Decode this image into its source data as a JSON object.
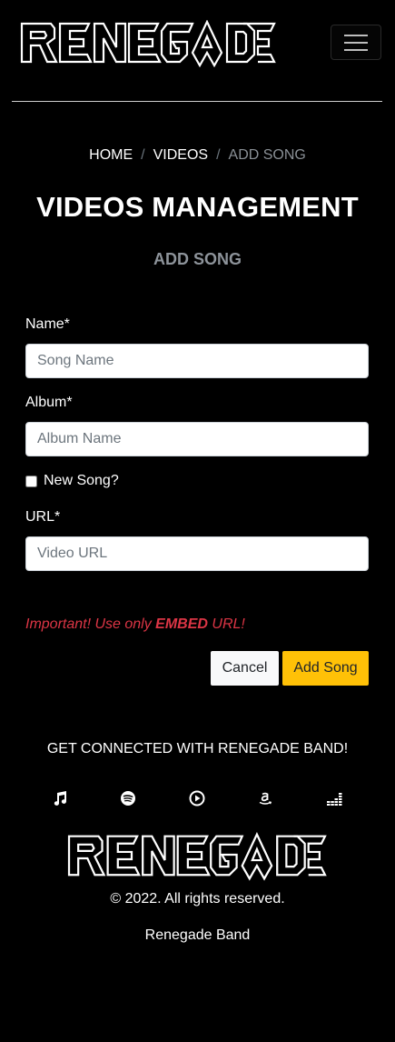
{
  "brand": {
    "name": "RENEGADE"
  },
  "nav": {
    "toggle_icon": "hamburger-icon"
  },
  "breadcrumb": {
    "items": [
      {
        "label": "HOME"
      },
      {
        "label": "VIDEOS"
      },
      {
        "label": "ADD SONG"
      }
    ],
    "separator": "/"
  },
  "page": {
    "title": "VIDEOS MANAGEMENT",
    "subtitle": "ADD SONG"
  },
  "form": {
    "name": {
      "label": "Name*",
      "placeholder": "Song Name",
      "value": ""
    },
    "album": {
      "label": "Album*",
      "placeholder": "Album Name",
      "value": ""
    },
    "new_song": {
      "label": "New Song?",
      "checked": false
    },
    "url": {
      "label": "URL*",
      "placeholder": "Video URL",
      "value": ""
    },
    "warning": {
      "prefix": "Important! Use only ",
      "emphasis": "EMBED",
      "suffix": " URL!"
    },
    "cancel_label": "Cancel",
    "submit_label": "Add Song"
  },
  "footer": {
    "heading": "GET CONNECTED WITH RENEGADE BAND!",
    "social_icons": [
      "music-note-icon",
      "spotify-icon",
      "play-circle-icon",
      "amazon-icon",
      "deezer-icon"
    ],
    "logo_text": "RENEGADE",
    "copyright": "© 2022. All rights reserved.",
    "band": "Renegade Band"
  },
  "colors": {
    "background": "#000000",
    "accent": "#ffc107",
    "warning": "#dc3545",
    "muted": "#8d939a"
  }
}
